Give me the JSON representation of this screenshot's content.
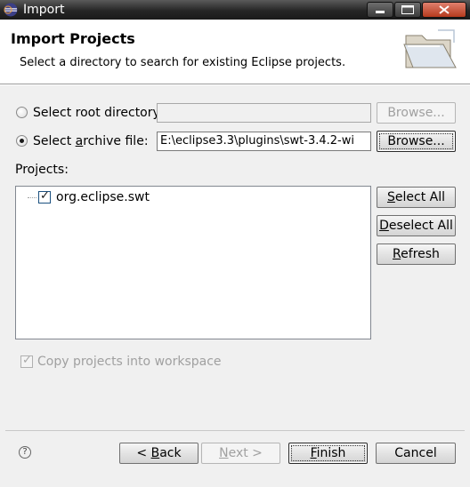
{
  "window": {
    "title": "Import"
  },
  "header": {
    "title": "Import Projects",
    "message": "Select a directory to search for existing Eclipse projects."
  },
  "source": {
    "root_directory": {
      "label": "Select root directory:",
      "selected": false,
      "value": "",
      "browse_label": "Browse...",
      "enabled": false
    },
    "archive_file": {
      "label": "Select archive file:",
      "selected": true,
      "value": "E:\\eclipse3.3\\plugins\\swt-3.4.2-wi",
      "browse_label": "Browse...",
      "enabled": true
    }
  },
  "projects": {
    "label": "Projects:",
    "items": [
      {
        "name": "org.eclipse.swt",
        "checked": true
      }
    ],
    "select_all_label": "Select All",
    "deselect_all_label": "Deselect All",
    "refresh_label": "Refresh"
  },
  "options": {
    "copy_into_workspace_label": "Copy projects into workspace",
    "checked": true,
    "enabled": false
  },
  "footer": {
    "back_label": "< Back",
    "next_label": "Next >",
    "finish_label": "Finish",
    "cancel_label": "Cancel"
  }
}
